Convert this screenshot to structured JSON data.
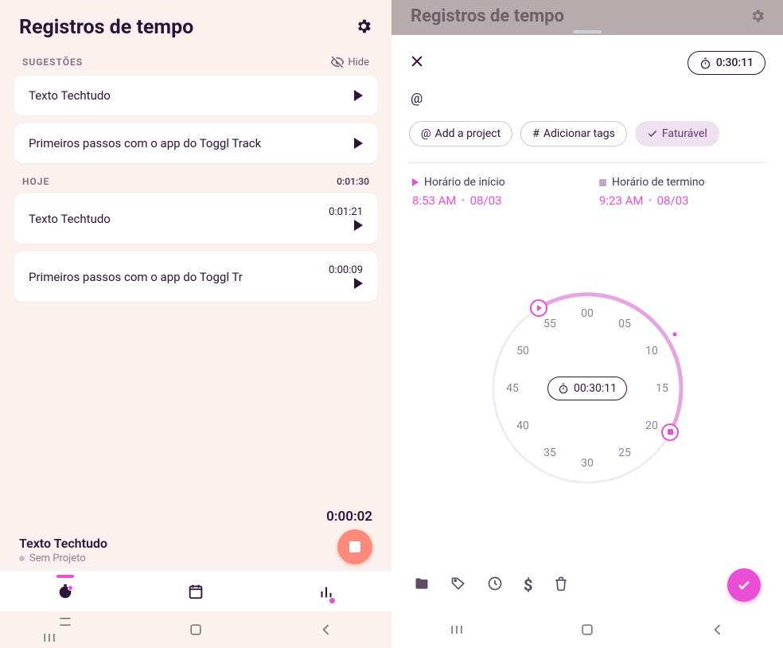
{
  "left": {
    "title": "Registros de tempo",
    "suggestions_label": "SUGESTÕES",
    "hide_label": "Hide",
    "suggestions": [
      {
        "title": "Texto Techtudo"
      },
      {
        "title": "Primeiros passos com o app do Toggl Track"
      }
    ],
    "today_label": "HOJE",
    "today_total": "0:01:30",
    "today": [
      {
        "title": "Texto Techtudo",
        "duration": "0:01:21"
      },
      {
        "title": "Primeiros passos com o app do Toggl Tr",
        "duration": "0:00:09"
      }
    ],
    "running": {
      "title": "Texto Techtudo",
      "subtitle": "Sem Projeto",
      "elapsed": "0:00:02"
    }
  },
  "right": {
    "dim_title": "Registros de tempo",
    "timer": "0:30:11",
    "at": "@",
    "chip_project": "Add a project",
    "chip_tags": "Adicionar tags",
    "chip_billable": "Faturável",
    "start_label": "Horário de início",
    "start_time": "8:53 AM",
    "start_date": "08/03",
    "end_label": "Horário de termino",
    "end_time": "9:23 AM",
    "end_date": "08/03",
    "wheel_center": "00:30:11",
    "ticks": [
      "00",
      "05",
      "10",
      "15",
      "20",
      "25",
      "30",
      "35",
      "40",
      "45",
      "50",
      "55"
    ]
  }
}
